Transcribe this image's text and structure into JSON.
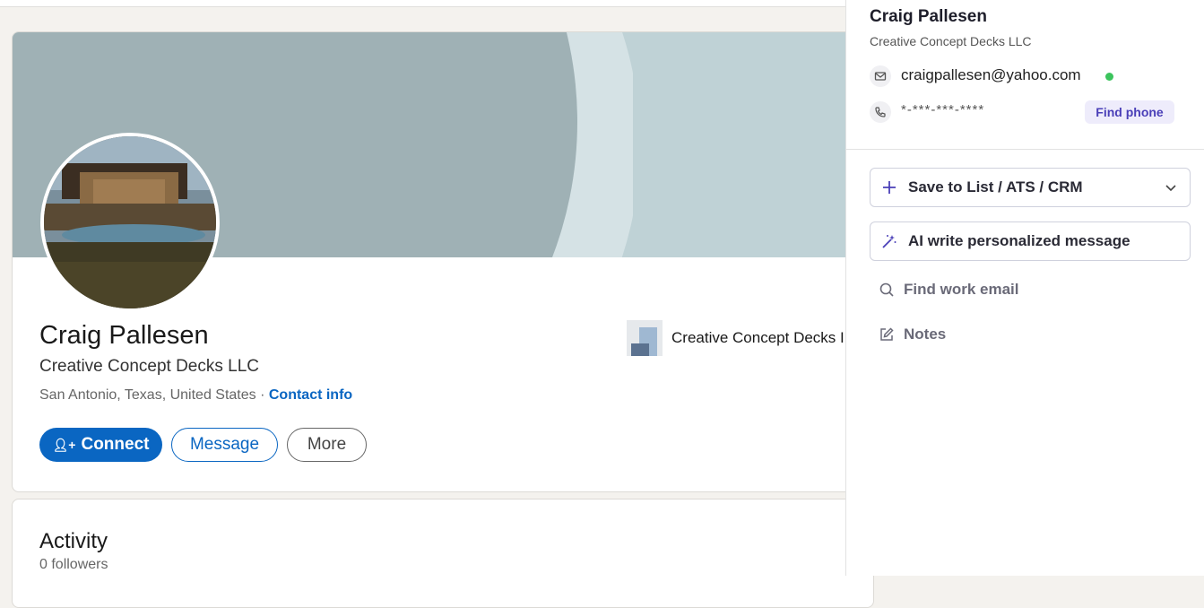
{
  "profile": {
    "name": "Craig Pallesen",
    "headline": "Creative Concept Decks LLC",
    "location": "San Antonio, Texas, United States · ",
    "contact_info": "Contact info",
    "buttons": {
      "connect": "Connect",
      "message": "Message",
      "more": "More"
    },
    "company": "Creative Concept Decks I",
    "colors": {
      "primary": "#0a66c2"
    }
  },
  "activity": {
    "title": "Activity",
    "followers": "0 followers"
  },
  "extension": {
    "name": "Craig Pallesen",
    "company": "Creative Concept Decks LLC",
    "email": "craigpallesen@yahoo.com",
    "phone_masked": "*-***-***-****",
    "find_phone": "Find phone",
    "save_label": "Save to List / ATS / CRM",
    "ai_label": "AI write personalized message",
    "find_work_email": "Find work email",
    "notes": "Notes",
    "colors": {
      "accent": "#4a3fb8",
      "verified": "#3cc45d"
    }
  }
}
